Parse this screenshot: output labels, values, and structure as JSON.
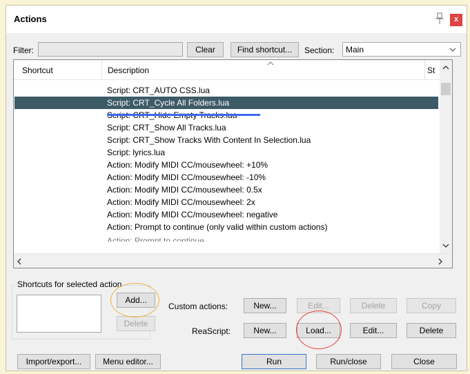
{
  "window": {
    "title": "Actions"
  },
  "filter": {
    "label": "Filter:",
    "value": "",
    "clear_label": "Clear",
    "find_shortcut_label": "Find shortcut...",
    "section_label": "Section:",
    "section_value": "Main"
  },
  "list": {
    "columns": [
      "Shortcut",
      "Description",
      "St"
    ],
    "rows": [
      "Script: CRT_AUTO CSS.lua",
      "Script: CRT_Cycle All Folders.lua",
      "Script: CRT_Hide Empty Tracks.lua",
      "Script: CRT_Show All Tracks.lua",
      "Script: CRT_Show Tracks With Content In Selection.lua",
      "Script: lyrics.lua",
      "Action: Modify MIDI CC/mousewheel: +10%",
      "Action: Modify MIDI CC/mousewheel: -10%",
      "Action: Modify MIDI CC/mousewheel: 0.5x",
      "Action: Modify MIDI CC/mousewheel: 2x",
      "Action: Modify MIDI CC/mousewheel: negative",
      "Action: Prompt to continue (only valid within custom actions)"
    ],
    "selected_index": 1
  },
  "shortcuts": {
    "group_label": "Shortcuts for selected action",
    "add_label": "Add...",
    "delete_label": "Delete"
  },
  "custom_actions": {
    "label": "Custom actions:",
    "new": "New...",
    "edit": "Edit...",
    "delete": "Delete",
    "copy": "Copy"
  },
  "reascript": {
    "label": "ReaScript:",
    "new": "New...",
    "load": "Load...",
    "edit": "Edit...",
    "delete": "Delete"
  },
  "bottom": {
    "import_export": "Import/export...",
    "menu_editor": "Menu editor...",
    "run": "Run",
    "run_close": "Run/close",
    "close": "Close"
  },
  "icons": {
    "pin": "pin-icon",
    "close": "close-icon",
    "dropdown": "chevron-down-icon"
  },
  "colors": {
    "selection": "#3d5a67",
    "close_bg": "#e04343",
    "highlight_orange": "#f0b346",
    "highlight_red": "#ea3b3b",
    "underline_blue": "#3f66ee"
  }
}
